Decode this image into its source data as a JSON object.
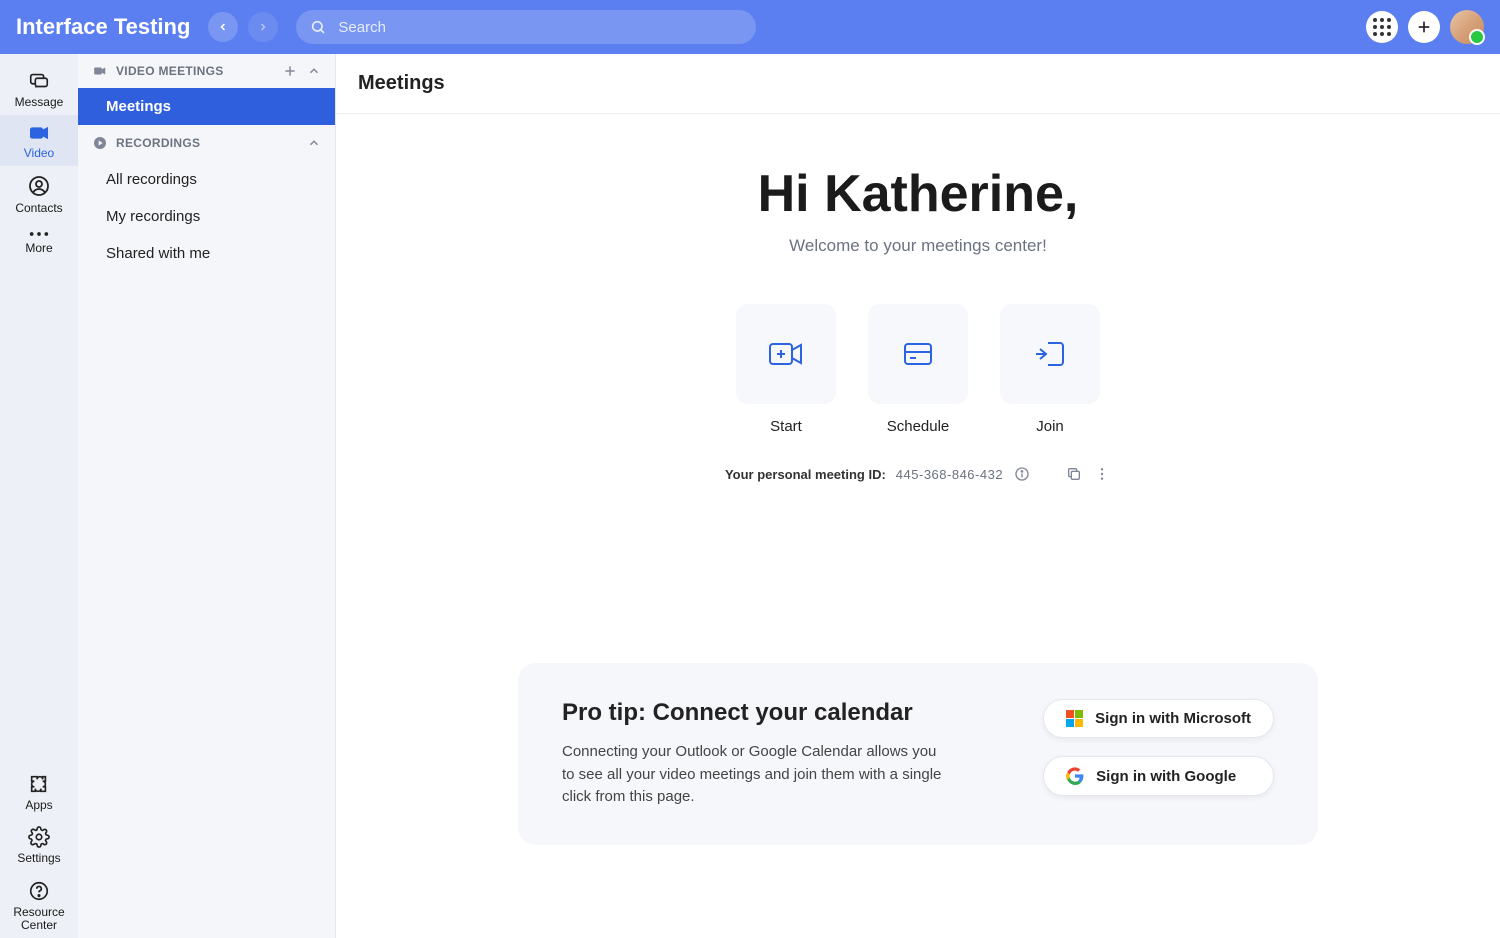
{
  "header": {
    "app_title": "Interface Testing",
    "search_placeholder": "Search"
  },
  "rail": {
    "items": [
      {
        "key": "message",
        "label": "Message"
      },
      {
        "key": "video",
        "label": "Video"
      },
      {
        "key": "contacts",
        "label": "Contacts"
      },
      {
        "key": "more",
        "label": "More"
      }
    ],
    "footer": [
      {
        "key": "apps",
        "label": "Apps"
      },
      {
        "key": "settings",
        "label": "Settings"
      },
      {
        "key": "resource",
        "label": "Resource Center"
      }
    ]
  },
  "subnav": {
    "video_section_label": "VIDEO MEETINGS",
    "video_items": [
      {
        "key": "meetings",
        "label": "Meetings"
      }
    ],
    "recordings_section_label": "RECORDINGS",
    "recordings_items": [
      {
        "key": "all",
        "label": "All recordings"
      },
      {
        "key": "my",
        "label": "My recordings"
      },
      {
        "key": "shared",
        "label": "Shared with me"
      }
    ]
  },
  "content": {
    "page_title": "Meetings",
    "greeting": "Hi Katherine,",
    "subgreeting": "Welcome to your meetings center!",
    "actions": {
      "start": "Start",
      "schedule": "Schedule",
      "join": "Join"
    },
    "pmi": {
      "label": "Your personal meeting ID:",
      "value": "445-368-846-432"
    },
    "tip": {
      "title": "Pro tip: Connect your calendar",
      "desc": "Connecting your Outlook or Google Calendar allows you to see all your video meetings and join them with a single click from this page.",
      "microsoft": "Sign in with Microsoft",
      "google": "Sign in with Google"
    }
  }
}
